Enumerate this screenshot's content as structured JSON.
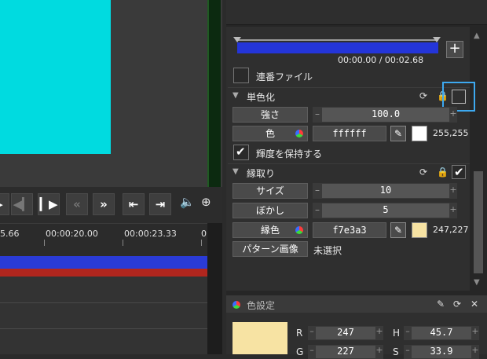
{
  "timeline": {
    "ticks": [
      "5.66",
      "00:00:20.00",
      "00:00:23.33",
      "0"
    ]
  },
  "properties": {
    "time_readout": "00:00.00 / 00:02.68",
    "add_button": "+",
    "sequential_file_label": "連番ファイル",
    "monochrome": {
      "title": "単色化",
      "strength_label": "強さ",
      "strength_value": "100.0",
      "color_label": "色",
      "color_hex": "ffffff",
      "color_rgb": "255,255",
      "swatch_color": "#ffffff",
      "keep_luminance_label": "輝度を保持する"
    },
    "border": {
      "title": "縁取り",
      "size_label": "サイズ",
      "size_value": "10",
      "blur_label": "ぼかし",
      "blur_value": "5",
      "color_label": "縁色",
      "color_hex": "f7e3a3",
      "color_rgb": "247,227",
      "swatch_color": "#f7e3a3",
      "pattern_label": "パターン画像",
      "pattern_value": "未選択"
    }
  },
  "color_panel": {
    "title": "色設定",
    "preview_color": "#f7e3a3",
    "r_label": "R",
    "r_value": "247",
    "g_label": "G",
    "g_value": "227",
    "h_label": "H",
    "h_value": "45.7",
    "s_label": "S",
    "s_value": "33.9"
  }
}
